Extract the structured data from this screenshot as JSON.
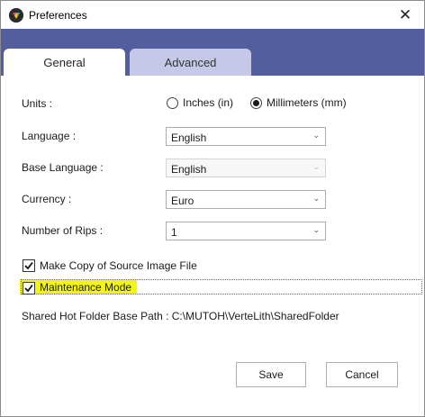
{
  "window": {
    "title": "Preferences",
    "close_glyph": "✕",
    "app_icon": "vertelith-app-icon"
  },
  "tabs": [
    {
      "label": "General",
      "selected": true
    },
    {
      "label": "Advanced",
      "selected": false
    }
  ],
  "general": {
    "units": {
      "label": "Units :",
      "options": [
        {
          "label": "Inches (in)",
          "selected": false
        },
        {
          "label": "Millimeters (mm)",
          "selected": true
        }
      ]
    },
    "language": {
      "label": "Language :",
      "value": "English"
    },
    "base_language": {
      "label": "Base Language :",
      "value": "English",
      "enabled": false
    },
    "currency": {
      "label": "Currency :",
      "value": "Euro"
    },
    "number_of_rips": {
      "label": "Number of Rips :",
      "value": "1"
    },
    "make_copy": {
      "label": "Make Copy of Source Image File",
      "checked": true
    },
    "maintenance_mode": {
      "label": "Maintenance Mode",
      "checked": true,
      "highlighted": true
    },
    "shared_hot_folder": {
      "text": "Shared Hot Folder Base Path : C:\\MUTOH\\VerteLith\\SharedFolder"
    }
  },
  "buttons": {
    "save": "Save",
    "cancel": "Cancel"
  },
  "colors": {
    "tab_strip": "#525e9e",
    "inactive_tab": "#c5c9e7",
    "highlight": "#f2f516"
  }
}
